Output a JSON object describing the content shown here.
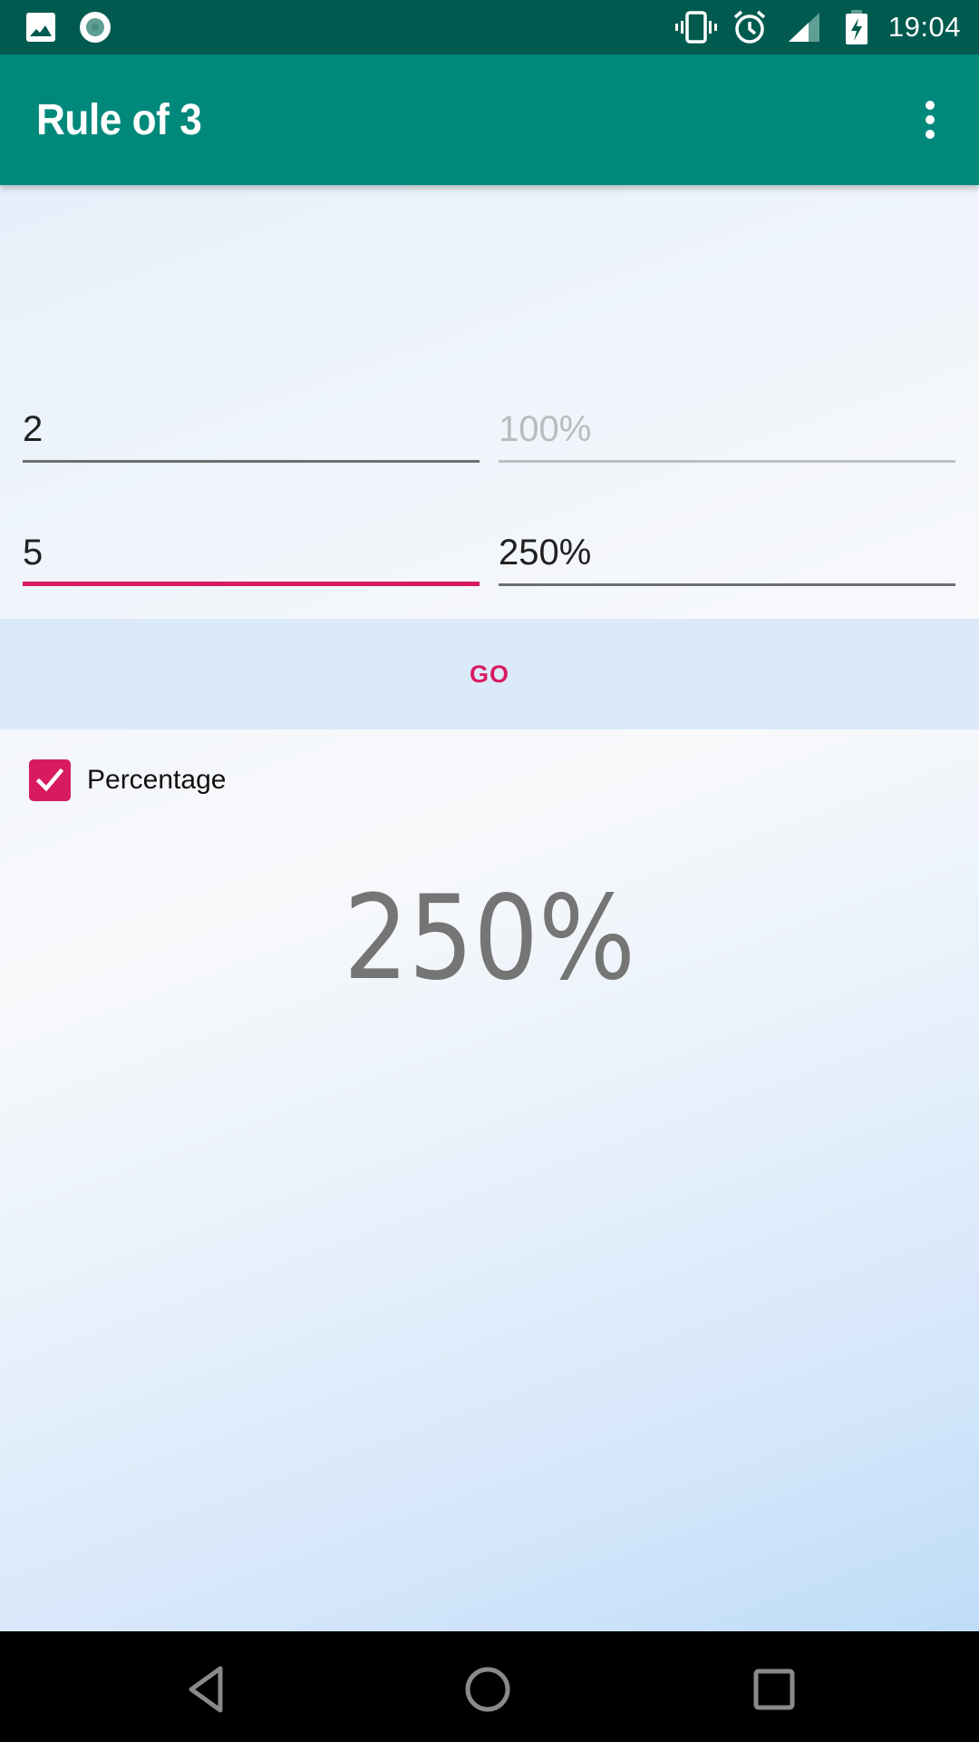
{
  "status_bar": {
    "left_icons": [
      "image-icon",
      "record-icon"
    ],
    "right_icons": [
      "vibrate-icon",
      "alarm-icon",
      "signal-icon",
      "battery-charging-icon"
    ],
    "time": "19:04"
  },
  "app_bar": {
    "title": "Rule of 3",
    "overflow_icon": "more-vert-icon"
  },
  "form": {
    "row1": {
      "left": {
        "value": "2",
        "placeholder": ""
      },
      "right": {
        "value": "",
        "placeholder": "100%"
      }
    },
    "row2": {
      "left": {
        "value": "5",
        "placeholder": "",
        "focused": true
      },
      "right": {
        "value": "250%",
        "placeholder": ""
      }
    }
  },
  "go_button": {
    "label": "GO"
  },
  "percentage_checkbox": {
    "label": "Percentage",
    "checked": true
  },
  "result": {
    "text": "250%"
  },
  "nav_bar": {
    "buttons": [
      "back-icon",
      "home-icon",
      "recents-icon"
    ]
  },
  "colors": {
    "status_bar": "#005a4f",
    "app_bar": "#00897b",
    "accent": "#d81b60",
    "result_text": "#757575"
  }
}
